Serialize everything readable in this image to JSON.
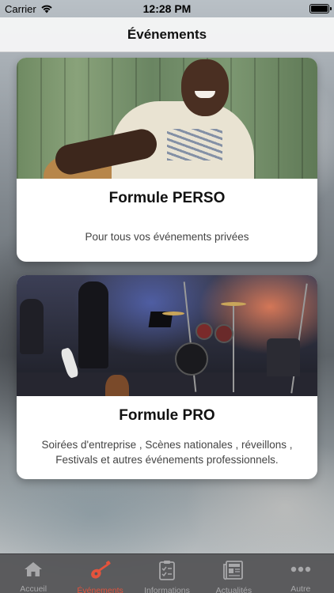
{
  "status_bar": {
    "carrier": "Carrier",
    "time": "12:28 PM",
    "battery_level": 1.0
  },
  "nav": {
    "title": "Événements"
  },
  "cards": [
    {
      "title": "Formule PERSO",
      "description": "Pour tous vos événements privées",
      "image": "guitarist-photo"
    },
    {
      "title": "Formule PRO",
      "description": "Soirées d'entreprise , Scènes nationales , réveillons , Festivals et autres événements professionnels.",
      "image": "stage-drums-photo"
    }
  ],
  "tab_bar": {
    "active_index": 1,
    "active_color": "#e4533c",
    "inactive_color": "#a8a8aa",
    "items": [
      {
        "label": "Accueil",
        "icon": "home-icon"
      },
      {
        "label": "Événements",
        "icon": "guitar-icon"
      },
      {
        "label": "Informations",
        "icon": "checklist-icon"
      },
      {
        "label": "Actualités",
        "icon": "newspaper-icon"
      },
      {
        "label": "Autre",
        "icon": "more-icon"
      }
    ]
  }
}
